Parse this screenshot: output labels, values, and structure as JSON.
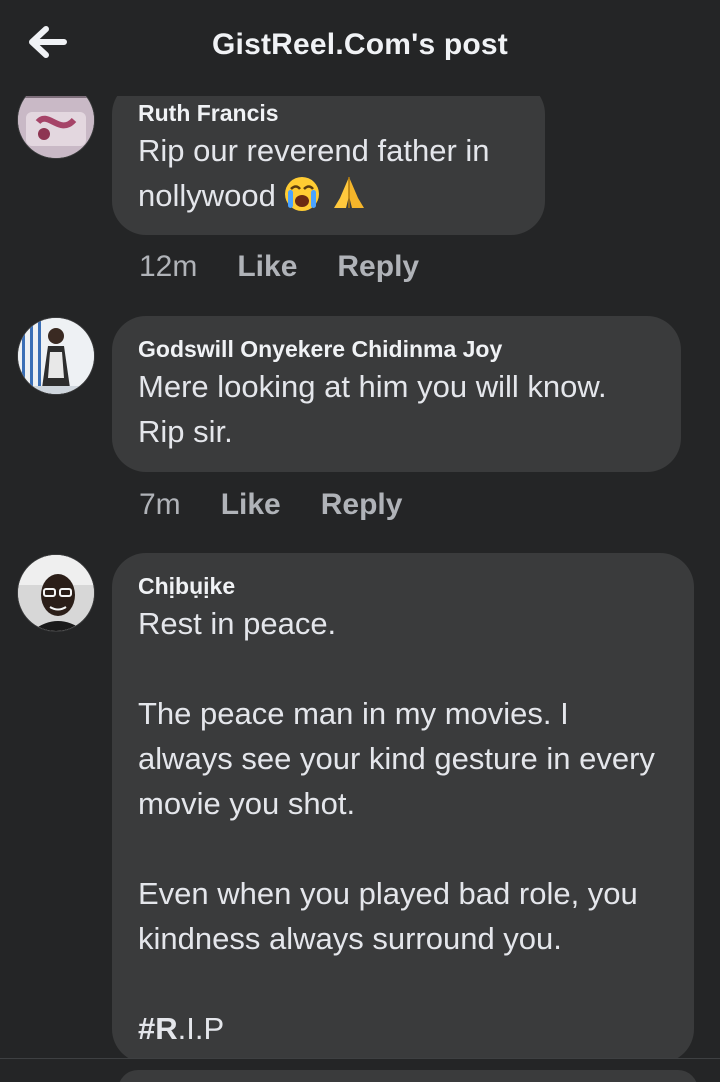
{
  "header": {
    "title": "GistReel.Com's post",
    "back_icon": "arrow-left-icon"
  },
  "comments": [
    {
      "author": "Ruth Francis",
      "text": "Rip our reverend father in nollywood",
      "emojis": [
        "crying-face-emoji",
        "folded-hands-emoji"
      ],
      "time": "12m",
      "like_label": "Like",
      "reply_label": "Reply"
    },
    {
      "author": "Godswill Onyekere Chidinma Joy",
      "text": "Mere looking at him you will know. Rip sir.",
      "time": "7m",
      "like_label": "Like",
      "reply_label": "Reply"
    },
    {
      "author": "Chịbụịke",
      "paragraph_1": "Rest in peace.",
      "paragraph_2": "The peace man in my movies. I always see your kind gesture in every movie you shot.",
      "paragraph_3": "Even when you played bad role, you kindness always surround you.",
      "hashtag_bold": "#R",
      "hashtag_rest": ".I.P"
    }
  ],
  "colors": {
    "background": "#242526",
    "bubble": "#3a3b3c",
    "text": "#e4e6eb",
    "muted": "#b0b3b8"
  }
}
